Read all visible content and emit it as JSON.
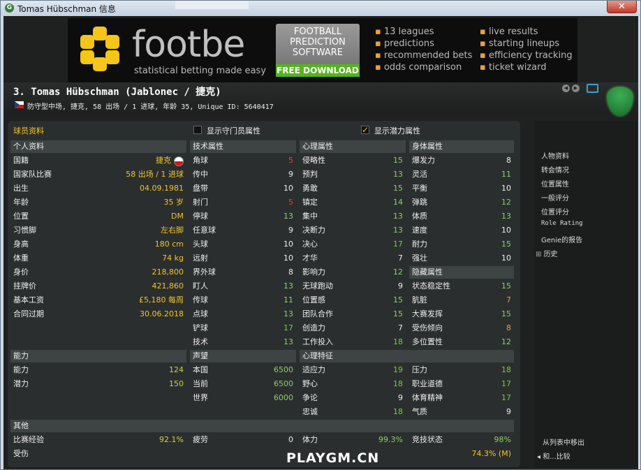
{
  "window": {
    "title": "Tomas Hübschman 信息",
    "close": "✕"
  },
  "banner": {
    "brand": "footbe",
    "tagline": "statistical betting made easy",
    "promo": [
      "FOOTBALL",
      "PREDICTION",
      "SOFTWARE"
    ],
    "download": "FREE DOWNLOAD",
    "features_left": [
      "13 leagues",
      "predictions",
      "recommended bets",
      "odds comparison"
    ],
    "features_right": [
      "live results",
      "starting lineups",
      "efficiency tracking",
      "ticket wizard"
    ]
  },
  "player": {
    "name": "3. Tomas Hübschman (Jablonec / 捷克)",
    "info": "防守型中场, 捷克, 58 出场 / 1 进球, 年龄 35, Unique ID: 5640417"
  },
  "tabs": {
    "profile": "球员资料",
    "show_gk": "显示守门员属性",
    "show_potential": "显示潜力属性"
  },
  "personal": {
    "header": "个人资料",
    "rows": [
      {
        "label": "国籍",
        "value": "捷克"
      },
      {
        "label": "国家队比赛",
        "value": "58 出场 / 1 进球"
      },
      {
        "label": "出生",
        "value": "04.09.1981"
      },
      {
        "label": "年龄",
        "value": "35 岁"
      },
      {
        "label": "位置",
        "value": "DM"
      },
      {
        "label": "习惯脚",
        "value": "左右脚"
      },
      {
        "label": "身高",
        "value": "180 cm"
      },
      {
        "label": "体重",
        "value": "74 kg"
      },
      {
        "label": "身价",
        "value": "218,800"
      },
      {
        "label": "挂牌价",
        "value": "421,860"
      },
      {
        "label": "基本工资",
        "value": "£5,180 每周"
      },
      {
        "label": "合同过期",
        "value": "30.06.2018"
      }
    ]
  },
  "technical": {
    "header": "技术属性",
    "rows": [
      {
        "label": "角球",
        "value": "5"
      },
      {
        "label": "传中",
        "value": "9"
      },
      {
        "label": "盘带",
        "value": "10"
      },
      {
        "label": "射门",
        "value": "5"
      },
      {
        "label": "停球",
        "value": "13"
      },
      {
        "label": "任意球",
        "value": "9"
      },
      {
        "label": "头球",
        "value": "10"
      },
      {
        "label": "远射",
        "value": "10"
      },
      {
        "label": "界外球",
        "value": "8"
      },
      {
        "label": "盯人",
        "value": "13"
      },
      {
        "label": "传球",
        "value": "11"
      },
      {
        "label": "点球",
        "value": "13"
      },
      {
        "label": "铲球",
        "value": "17"
      },
      {
        "label": "技术",
        "value": "13"
      }
    ]
  },
  "mental": {
    "header": "心理属性",
    "rows": [
      {
        "label": "侵略性",
        "value": "15"
      },
      {
        "label": "预判",
        "value": "13"
      },
      {
        "label": "勇敢",
        "value": "15"
      },
      {
        "label": "镇定",
        "value": "14"
      },
      {
        "label": "集中",
        "value": "13"
      },
      {
        "label": "决断力",
        "value": "13"
      },
      {
        "label": "决心",
        "value": "17"
      },
      {
        "label": "才华",
        "value": "7"
      },
      {
        "label": "影响力",
        "value": "12"
      },
      {
        "label": "无球跑动",
        "value": "9"
      },
      {
        "label": "位置感",
        "value": "15"
      },
      {
        "label": "团队合作",
        "value": "15"
      },
      {
        "label": "创造力",
        "value": "7"
      },
      {
        "label": "工作投入",
        "value": "18"
      }
    ]
  },
  "physical": {
    "header": "身体属性",
    "rows": [
      {
        "label": "爆发力",
        "value": "8"
      },
      {
        "label": "灵活",
        "value": "11"
      },
      {
        "label": "平衡",
        "value": "10"
      },
      {
        "label": "弹跳",
        "value": "12"
      },
      {
        "label": "体质",
        "value": "13"
      },
      {
        "label": "速度",
        "value": "10"
      },
      {
        "label": "耐力",
        "value": "15"
      },
      {
        "label": "强壮",
        "value": "10"
      }
    ]
  },
  "hidden": {
    "header": "隐藏属性",
    "rows": [
      {
        "label": "状态稳定性",
        "value": "15"
      },
      {
        "label": "肮脏",
        "value": "7"
      },
      {
        "label": "大赛发挥",
        "value": "15"
      },
      {
        "label": "受伤倾向",
        "value": "8"
      },
      {
        "label": "多位置性",
        "value": "12"
      }
    ]
  },
  "ability": {
    "header": "能力",
    "rows": [
      {
        "label": "能力",
        "value": "124"
      },
      {
        "label": "潜力",
        "value": "150"
      }
    ]
  },
  "reputation": {
    "header": "声望",
    "rows": [
      {
        "label": "本国",
        "value": "6500"
      },
      {
        "label": "当前",
        "value": "6500"
      },
      {
        "label": "世界",
        "value": "6000"
      }
    ]
  },
  "traits": {
    "header": "心理特征",
    "rows": [
      {
        "label": "适应力",
        "value": "19"
      },
      {
        "label": "野心",
        "value": "18"
      },
      {
        "label": "争论",
        "value": "9"
      },
      {
        "label": "忠诚",
        "value": "18"
      },
      {
        "label": "压力",
        "value": "18"
      },
      {
        "label": "职业道德",
        "value": "17"
      },
      {
        "label": "体育精神",
        "value": "17"
      },
      {
        "label": "气质",
        "value": "9"
      }
    ]
  },
  "other": {
    "header": "其他",
    "rows": [
      {
        "label": "比赛经验",
        "value": "92.1%"
      },
      {
        "label": "疲劳",
        "value": "0"
      },
      {
        "label": "体力",
        "value": "99.3%"
      },
      {
        "label": "竞技状态",
        "value": "98%"
      },
      {
        "label": "受伤",
        "value": ""
      },
      {
        "label": "",
        "value": "74.3% (M)"
      }
    ]
  },
  "sidebar": {
    "items": [
      "人物资料",
      "转会情况",
      "位置属性",
      "一般评分",
      "位置评分",
      "Role Rating",
      "Genie的报告",
      "历史"
    ],
    "bottom": [
      "从列表中移出",
      "和...比较"
    ]
  },
  "watermark": "PLAYGM.CN",
  "colors": {
    "accent": "#f3c623",
    "green": "#6fd03a",
    "header": "#3e4444"
  }
}
